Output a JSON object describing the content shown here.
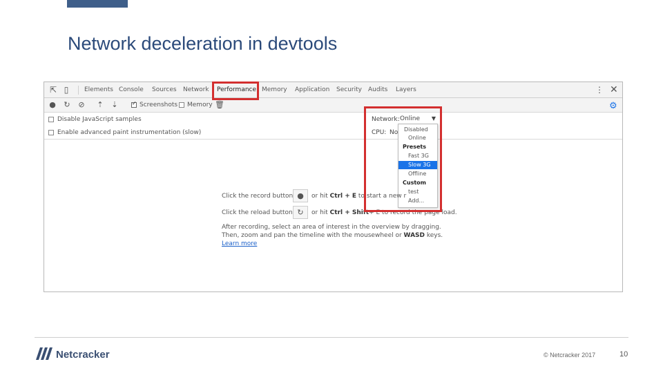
{
  "slide": {
    "title": "Network deceleration in devtools",
    "copyright": "© Netcracker 2017",
    "page_number": "10",
    "logo_text": "Netcracker"
  },
  "devtools": {
    "tabs": [
      {
        "label": "Elements"
      },
      {
        "label": "Console"
      },
      {
        "label": "Sources"
      },
      {
        "label": "Network"
      },
      {
        "label": "Performance",
        "active": true
      },
      {
        "label": "Memory"
      },
      {
        "label": "Application"
      },
      {
        "label": "Security"
      },
      {
        "label": "Audits"
      },
      {
        "label": "Layers"
      }
    ],
    "toolbar": {
      "screenshots_label": "Screenshots",
      "memory_label": "Memory"
    },
    "options": {
      "disable_js_samples": "Disable JavaScript samples",
      "advanced_paint": "Enable advanced paint instrumentation (slow)"
    },
    "network": {
      "label": "Network:",
      "selected": "Online",
      "options_groups": [
        {
          "items": [
            "Disabled",
            "Online"
          ],
          "group": ""
        },
        {
          "group": "Presets",
          "items": [
            "Fast 3G",
            "Slow 3G",
            "Offline"
          ]
        },
        {
          "group": "Custom",
          "items": [
            "test",
            "Add..."
          ]
        }
      ],
      "highlighted": "Slow 3G"
    },
    "cpu": {
      "label": "CPU:",
      "value": "No"
    },
    "landing": {
      "record_prefix": "Click the record button",
      "record_suffix_pre": "or hit ",
      "record_kbd": "Ctrl + E",
      "record_suffix_post": " to start a new r",
      "reload_prefix": "Click the reload button",
      "reload_suffix_pre": "or hit ",
      "reload_kbd": "Ctrl + Shift",
      "reload_suffix_post": "+ E to record the page load.",
      "after_line1": "After recording, select an area of interest in the overview by dragging.",
      "after_line2_pre": "Then, zoom and pan the timeline with the mousewheel or ",
      "after_line2_kbd": "WASD",
      "after_line2_post": " keys.",
      "learn_more": "Learn more"
    }
  },
  "colors": {
    "title": "#2b4a7a",
    "highlight": "#d32f2f",
    "accent": "#1a73e8"
  }
}
